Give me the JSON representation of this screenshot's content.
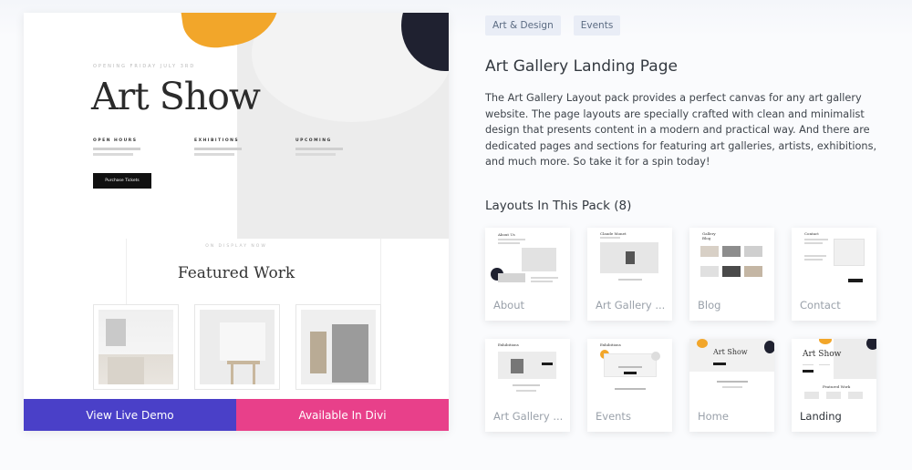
{
  "preview": {
    "hero_kicker": "OPENING FRIDAY JULY 3RD",
    "hero_title": "Art Show",
    "info_columns": [
      "OPEN HOURS",
      "EXHIBITIONS",
      "UPCOMING"
    ],
    "hero_button": "Purchase Tickets",
    "featured_kicker": "ON DISPLAY NOW",
    "featured_title": "Featured Work",
    "demo_button": "View Live Demo",
    "divi_button": "Available In Divi"
  },
  "tags": [
    "Art & Design",
    "Events"
  ],
  "layout_title": "Art Gallery Landing Page",
  "layout_description": "The Art Gallery Layout pack provides a perfect canvas for any art gallery website. The page layouts are specially crafted with clean and minimalist design that presents content in a modern and practical way. And there are dedicated pages and sections for featuring art galleries, artists, exhibitions, and much more. So take it for a spin today!",
  "pack_title": "Layouts In This Pack (8)",
  "layouts": [
    {
      "label": "About"
    },
    {
      "label": "Art Gallery ..."
    },
    {
      "label": "Blog"
    },
    {
      "label": "Contact"
    },
    {
      "label": "Art Gallery ..."
    },
    {
      "label": "Events"
    },
    {
      "label": "Home"
    },
    {
      "label": "Landing"
    }
  ],
  "colors": {
    "demo_button": "#4a40c8",
    "divi_button": "#e8408a",
    "accent_orange": "#f2a62a",
    "accent_navy": "#1f2130",
    "tag_bg": "#e9edf6"
  }
}
